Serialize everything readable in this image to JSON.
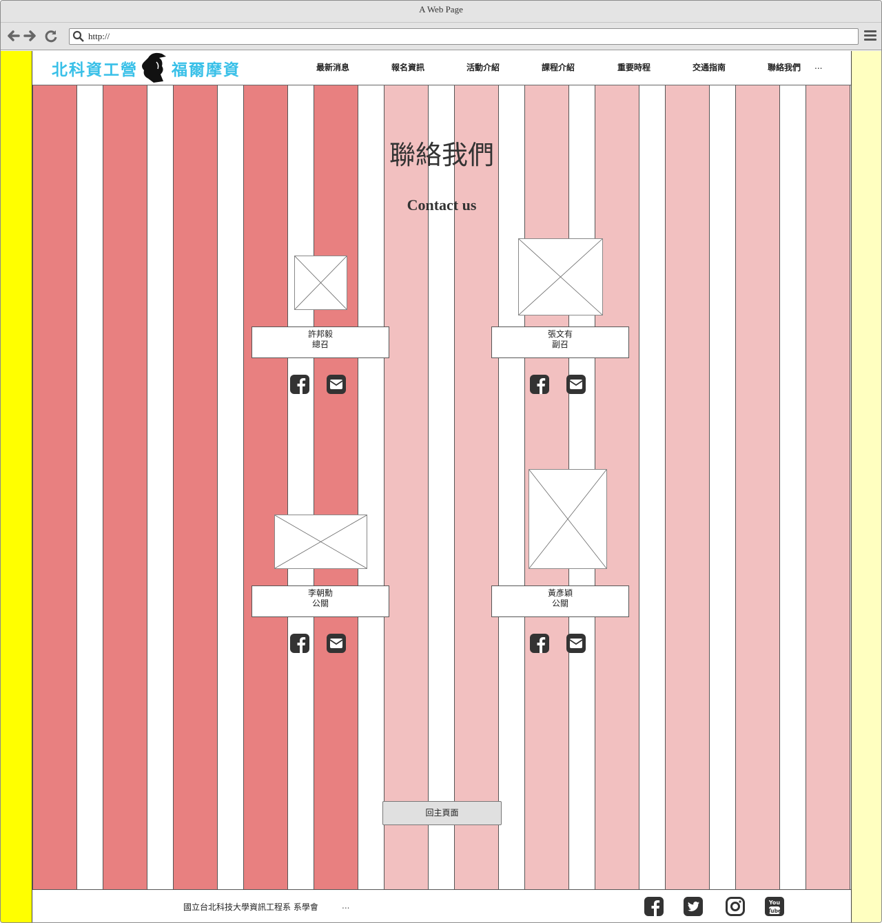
{
  "browser": {
    "title": "A Web Page",
    "url": "http://"
  },
  "logo": {
    "left_text": "北科資工營",
    "right_text": "福爾摩資"
  },
  "menu": [
    {
      "label": "最新消息"
    },
    {
      "label": "報名資訊"
    },
    {
      "label": "活動介紹"
    },
    {
      "label": "課程介紹"
    },
    {
      "label": "重要時程"
    },
    {
      "label": "交通指南"
    },
    {
      "label": "聯絡我們"
    },
    {
      "label": "..."
    }
  ],
  "main": {
    "title": "聯絡我們",
    "subtitle": "Contact us"
  },
  "members": [
    {
      "name": "許邦毅",
      "role": "總召"
    },
    {
      "name": "張文有",
      "role": "副召"
    },
    {
      "name": "李朝勳",
      "role": "公關"
    },
    {
      "name": "黃彥穎",
      "role": "公關"
    }
  ],
  "home_button": "回主頁面",
  "footer": {
    "text": "國立台北科技大學資訊工程系 系學會",
    "more": "..."
  },
  "colors": {
    "left_sidebar": "#ffff00",
    "right_sidebar": "#ffffc0",
    "stripe_dark": "#e88080",
    "stripe_light": "#f2c0c0",
    "logo_text": "#39c0e8"
  },
  "icons": {
    "facebook": "facebook-icon",
    "email": "envelope-icon",
    "twitter": "twitter-icon",
    "instagram": "instagram-icon",
    "youtube": "youtube-icon"
  }
}
